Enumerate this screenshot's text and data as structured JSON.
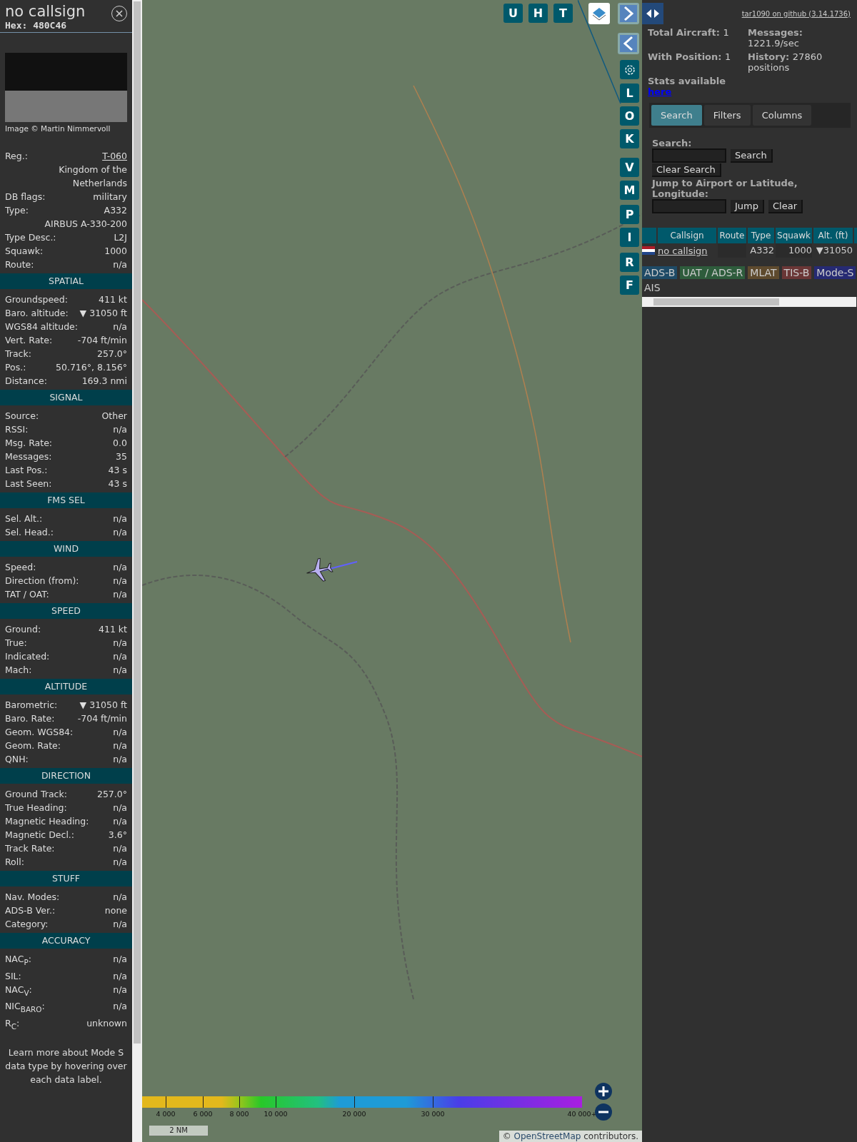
{
  "aircraft": {
    "title": "no callsign",
    "hex": "Hex: 480C46",
    "photo_credit": "Image © Martin Nimmervoll"
  },
  "info_rows": [
    {
      "kind": "link",
      "label": "Reg.:",
      "value": "T-060"
    },
    {
      "kind": "value",
      "value": "Kingdom of the Netherlands"
    },
    {
      "kind": "pair",
      "label": "DB flags:",
      "value": "military"
    },
    {
      "kind": "pair",
      "label": "Type:",
      "value": "A332"
    },
    {
      "kind": "value",
      "value": "AIRBUS A-330-200"
    },
    {
      "kind": "pair",
      "label": "Type Desc.:",
      "value": "L2J"
    },
    {
      "kind": "pair",
      "label": "Squawk:",
      "value": "1000"
    },
    {
      "kind": "pair",
      "label": "Route:",
      "value": "n/a"
    }
  ],
  "sections": [
    {
      "title": "SPATIAL",
      "rows": [
        {
          "label": "Groundspeed:",
          "value": "411 kt"
        },
        {
          "label": "Baro. altitude:",
          "value": "▼ 31050 ft"
        },
        {
          "label": "WGS84 altitude:",
          "value": "n/a"
        },
        {
          "label": "Vert. Rate:",
          "value": "-704 ft/min"
        },
        {
          "label": "Track:",
          "value": "257.0°"
        },
        {
          "label": "Pos.:",
          "value": "50.716°, 8.156°"
        },
        {
          "label": "Distance:",
          "value": "169.3 nmi"
        }
      ]
    },
    {
      "title": "SIGNAL",
      "rows": [
        {
          "label": "Source:",
          "value": "Other"
        },
        {
          "label": "RSSI:",
          "value": "n/a"
        },
        {
          "label": "Msg. Rate:",
          "value": "0.0"
        },
        {
          "label": "Messages:",
          "value": "35"
        },
        {
          "label": "Last Pos.:",
          "value": "43 s"
        },
        {
          "label": "Last Seen:",
          "value": "43 s"
        }
      ]
    },
    {
      "title": "FMS SEL",
      "rows": [
        {
          "label": "Sel. Alt.:",
          "value": "n/a"
        },
        {
          "label": "Sel. Head.:",
          "value": "n/a"
        }
      ]
    },
    {
      "title": "WIND",
      "rows": [
        {
          "label": "Speed:",
          "value": "n/a"
        },
        {
          "label": "Direction (from):",
          "value": "n/a"
        },
        {
          "label": "TAT / OAT:",
          "value": "n/a"
        }
      ]
    },
    {
      "title": "SPEED",
      "rows": [
        {
          "label": "Ground:",
          "value": "411 kt"
        },
        {
          "label": "True:",
          "value": "n/a"
        },
        {
          "label": "Indicated:",
          "value": "n/a"
        },
        {
          "label": "Mach:",
          "value": "n/a"
        }
      ]
    },
    {
      "title": "ALTITUDE",
      "rows": [
        {
          "label": "Barometric:",
          "value": "▼ 31050 ft"
        },
        {
          "label": "Baro. Rate:",
          "value": "-704 ft/min"
        },
        {
          "label": "Geom. WGS84:",
          "value": "n/a"
        },
        {
          "label": "Geom. Rate:",
          "value": "n/a"
        },
        {
          "label": "QNH:",
          "value": "n/a"
        }
      ]
    },
    {
      "title": "DIRECTION",
      "rows": [
        {
          "label": "Ground Track:",
          "value": "257.0°"
        },
        {
          "label": "True Heading:",
          "value": "n/a"
        },
        {
          "label": "Magnetic Heading:",
          "value": "n/a"
        },
        {
          "label": "Magnetic Decl.:",
          "value": "3.6°"
        },
        {
          "label": "Track Rate:",
          "value": "n/a"
        },
        {
          "label": "Roll:",
          "value": "n/a"
        }
      ]
    },
    {
      "title": "STUFF",
      "rows": [
        {
          "label": "Nav. Modes:",
          "value": "n/a"
        },
        {
          "label": "ADS-B Ver.:",
          "value": "none"
        },
        {
          "label": "Category:",
          "value": "n/a"
        }
      ]
    },
    {
      "title": "ACCURACY",
      "rows": [
        {
          "label": "NAC$_{P}$:",
          "value": "n/a"
        },
        {
          "label": "SIL:",
          "value": "n/a"
        },
        {
          "label": "NAC$_{V}$:",
          "value": "n/a"
        },
        {
          "label": "NIC$_{BARO}$:",
          "value": "n/a"
        },
        {
          "label": "R$_{C}$:",
          "value": "unknown"
        }
      ]
    }
  ],
  "note": "Learn more about Mode S data type by hovering over each data label.",
  "map": {
    "top_buttons": [
      "U",
      "H",
      "T"
    ],
    "side_buttons": [
      {
        "kind": "next"
      },
      {
        "kind": "prev"
      },
      {
        "kind": "settings"
      },
      {
        "kind": "letter",
        "label": "L"
      },
      {
        "kind": "letter",
        "label": "O"
      },
      {
        "kind": "letter",
        "label": "K"
      },
      {
        "kind": "letter",
        "label": "V"
      },
      {
        "kind": "letter",
        "label": "M"
      },
      {
        "kind": "letter",
        "label": "P"
      },
      {
        "kind": "letter",
        "label": "I"
      },
      {
        "kind": "letter",
        "label": "R"
      },
      {
        "kind": "letter",
        "label": "F"
      }
    ],
    "legend_labels": [
      "4 000",
      "6 000",
      "8 000",
      "10 000",
      "20 000",
      "30 000",
      "40 000+"
    ],
    "scale": "2 NM",
    "attribution_prefix": "©",
    "attribution_link": "OpenStreetMap",
    "attribution_suffix": "contributors."
  },
  "sidebar": {
    "version_link": "tar1090 on github (3.14.1736)",
    "stats": [
      {
        "label": "Total Aircraft:",
        "value": "1"
      },
      {
        "label": "Messages:",
        "value": "1221.9/sec"
      },
      {
        "label": "With Position:",
        "value": "1"
      },
      {
        "label": "History:",
        "value": "27860 positions"
      }
    ],
    "stats_note": "Stats available",
    "stats_link": "here",
    "tabs": [
      {
        "label": "Search",
        "selected": true
      },
      {
        "label": "Filters",
        "selected": false
      },
      {
        "label": "Columns",
        "selected": false
      }
    ],
    "search_label": "Search:",
    "search_button": "Search",
    "clear_search_button": "Clear Search",
    "jump_label": "Jump to Airport or Latitude, Longitude:",
    "jump_button": "Jump",
    "clear_button": "Clear",
    "columns": [
      "Callsign",
      "Route",
      "Type",
      "Squawk",
      "Alt. (ft)"
    ],
    "rows": [
      {
        "callsign": "no callsign",
        "type": "A332",
        "squawk": "1000",
        "altitude": "▼31050"
      }
    ],
    "sources": [
      {
        "label": "ADS-B",
        "color": "#1e4a66"
      },
      {
        "label": "UAT / ADS-R",
        "color": "#2e5c3c"
      },
      {
        "label": "MLAT",
        "color": "#5e4a2e"
      },
      {
        "label": "TIS-B",
        "color": "#6a3636"
      },
      {
        "label": "Mode-S",
        "color": "#262a73"
      },
      {
        "label": "AIS",
        "color": "#303030"
      }
    ]
  }
}
